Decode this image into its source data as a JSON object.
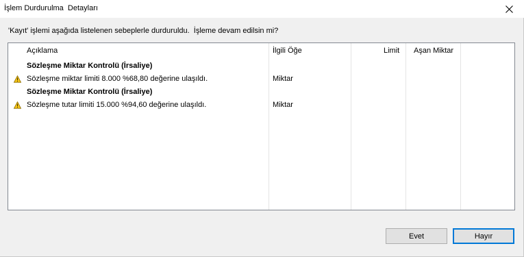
{
  "window": {
    "title": "İşlem Durdurulma  Detayları"
  },
  "message": "'Kayıt' işlemi aşağıda listelenen sebeplerle durduruldu.  İşleme devam edilsin mi?",
  "table": {
    "columns": [
      "Açıklama",
      "İlgili Öğe",
      "Limit",
      "Aşan Miktar"
    ],
    "groups": [
      {
        "heading": "Sözleşme Miktar Kontrolü (İrsaliye)",
        "icon": "warning-icon",
        "description": "Sözleşme miktar limiti 8.000 %68,80 değerine ulaşıldı.",
        "item": "Miktar",
        "limit": "",
        "exceeded": ""
      },
      {
        "heading": "Sözleşme Miktar Kontrolü (İrsaliye)",
        "icon": "warning-icon",
        "description": "Sözleşme tutar limiti 15.000 %94,60 değerine ulaşıldı.",
        "item": "Miktar",
        "limit": "",
        "exceeded": ""
      }
    ]
  },
  "buttons": {
    "yes": "Evet",
    "no": "Hayır"
  },
  "colors": {
    "warning_fill": "#f5c518",
    "default_button_border": "#0078d7"
  }
}
